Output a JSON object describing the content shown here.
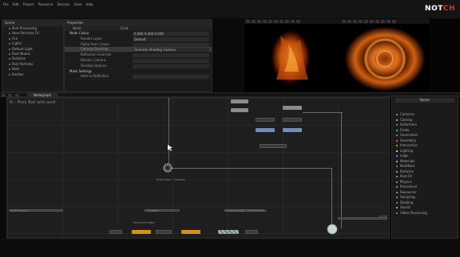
{
  "app": {
    "brand_left": "NOT",
    "brand_right": "CH"
  },
  "menu": [
    "File",
    "Edit",
    "Project",
    "Resource",
    "Devices",
    "View",
    "Help"
  ],
  "scene_panel": {
    "title": "Scene",
    "items": [
      "Post Processing",
      "Hero Particles FX",
      "Fire",
      "Lights",
      "Default Light",
      "Root Nodes",
      "Particles",
      "Post Particles",
      "Root",
      "Emitter"
    ]
  },
  "properties_panel": {
    "title": "Properties",
    "header_cols": [
      "Node",
      "Field"
    ],
    "rows": [
      {
        "label": "Node Colour",
        "value": "0.000 0.000 0.000",
        "type": "section"
      },
      {
        "label": "Render Layer",
        "value": "Default",
        "type": "row"
      },
      {
        "label": "Alpha from Colour",
        "value": "",
        "type": "row"
      },
      {
        "label": "Camera Override",
        "value": "Override Shading Camera",
        "type": "sel"
      },
      {
        "label": "Reflection Override",
        "value": "",
        "type": "row"
      },
      {
        "label": "Render Camera",
        "value": "",
        "type": "row"
      },
      {
        "label": "Shadow Options",
        "value": "",
        "type": "row"
      },
      {
        "label": "Mask Settings",
        "value": "",
        "type": "section"
      },
      {
        "label": "Hide In Reflection",
        "value": "",
        "type": "row"
      }
    ]
  },
  "viewport": {
    "toolbar_buttons": 10
  },
  "toolbar": {
    "active_tab": "Nodegraph"
  },
  "nodegraph": {
    "title": "Ki - Fiery Ball with ascii",
    "captions": {
      "center": "Stick Point - Camera",
      "left": "Post Process",
      "mid": "Camera",
      "right": "Camera Orbit - Ring Particles",
      "small": "Particle Emitter",
      "bottom": "Video Loader",
      "value": "0.000"
    }
  },
  "nodes_panel": {
    "title": "Nodes",
    "categories": [
      {
        "label": "Cameras",
        "color": "#6f8ebc"
      },
      {
        "label": "Cloning",
        "color": "#d0a040"
      },
      {
        "label": "Deformers",
        "color": "#7a7a7a"
      },
      {
        "label": "Fields",
        "color": "#60b060"
      },
      {
        "label": "Generators",
        "color": "#4080c0"
      },
      {
        "label": "Geometry",
        "color": "#c06060"
      },
      {
        "label": "Interactive",
        "color": "#d48a20"
      },
      {
        "label": "Lighting",
        "color": "#d0d060"
      },
      {
        "label": "Logic",
        "color": "#a060c0"
      },
      {
        "label": "Materials",
        "color": "#80c0c0"
      },
      {
        "label": "Modifiers",
        "color": "#5080a0"
      },
      {
        "label": "Particles",
        "color": "#d0a040"
      },
      {
        "label": "Post-FX",
        "color": "#8080d0"
      },
      {
        "label": "Physics",
        "color": "#60a060"
      },
      {
        "label": "Procedural",
        "color": "#c08040"
      },
      {
        "label": "Resources",
        "color": "#909090"
      },
      {
        "label": "Sampling",
        "color": "#5090c0"
      },
      {
        "label": "Shading",
        "color": "#b06090"
      },
      {
        "label": "Sound",
        "color": "#70b0b0"
      },
      {
        "label": "Video Processing",
        "color": "#d06040"
      }
    ]
  }
}
